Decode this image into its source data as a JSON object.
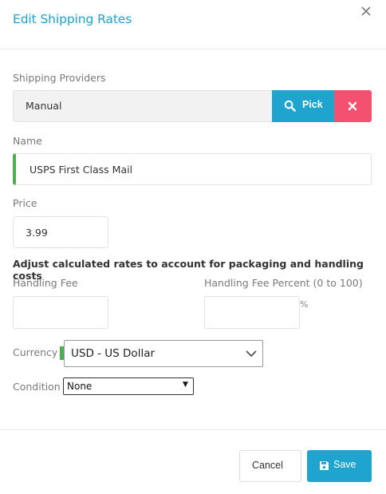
{
  "dialog": {
    "title": "Edit Shipping Rates",
    "close_icon": "close-icon"
  },
  "shipping_providers": {
    "label": "Shipping Providers",
    "value": "Manual",
    "pick_label": "Pick",
    "pick_icon": "search-icon",
    "clear_icon": "times-icon"
  },
  "name": {
    "label": "Name",
    "value": "USPS First Class Mail"
  },
  "price": {
    "label": "Price",
    "value": "3.99"
  },
  "adjust_heading": "Adjust calculated rates to account for packaging and handling costs",
  "handling_fee": {
    "label": "Handling Fee",
    "value": ""
  },
  "handling_fee_percent": {
    "label": "Handling Fee Percent (0 to 100)",
    "suffix": "%",
    "value": ""
  },
  "currency": {
    "label": "Currency",
    "selected": "USD - US Dollar",
    "icon": "chevron-down-icon"
  },
  "condition": {
    "label": "Condition",
    "selected": "None",
    "arrow": "▼"
  },
  "footer": {
    "cancel_label": "Cancel",
    "save_label": "Save",
    "save_icon": "floppy-disk-icon"
  },
  "colors": {
    "accent": "#1fa3cf",
    "danger": "#f4506f",
    "required_marker": "#4caf50"
  }
}
